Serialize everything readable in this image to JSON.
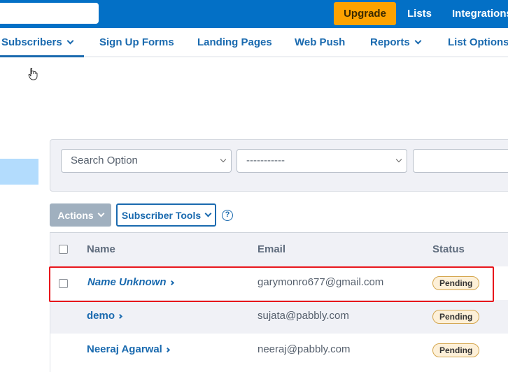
{
  "topbar": {
    "search_value": "",
    "upgrade_label": "Upgrade",
    "links": [
      "Lists",
      "Integrations"
    ],
    "bg_color": "#0370c6",
    "upgrade_color": "#fda200"
  },
  "subnav": {
    "items": [
      {
        "label": "Subscribers",
        "has_dropdown": true,
        "active": true
      },
      {
        "label": "Sign Up Forms",
        "has_dropdown": false
      },
      {
        "label": "Landing Pages",
        "has_dropdown": false
      },
      {
        "label": "Web Push",
        "has_dropdown": false
      },
      {
        "label": "Reports",
        "has_dropdown": true
      },
      {
        "label": "List Options",
        "has_dropdown": false
      }
    ]
  },
  "filters": {
    "search_option": "Search Option",
    "operator": "-----------",
    "value": ""
  },
  "toolbar": {
    "actions_label": "Actions",
    "tools_label": "Subscriber Tools",
    "help_icon": "?"
  },
  "table": {
    "headers": {
      "name": "Name",
      "email": "Email",
      "status": "Status"
    },
    "rows": [
      {
        "name": "Name Unknown",
        "name_italic": true,
        "email": "garymonro677@gmail.com",
        "status": "Pending",
        "has_checkbox": true,
        "highlighted": true
      },
      {
        "name": "demo",
        "name_italic": false,
        "email": "sujata@pabbly.com",
        "status": "Pending",
        "has_checkbox": false
      },
      {
        "name": "Neeraj Agarwal",
        "name_italic": false,
        "email": "neeraj@pabbly.com",
        "status": "Pending",
        "has_checkbox": false
      }
    ]
  }
}
